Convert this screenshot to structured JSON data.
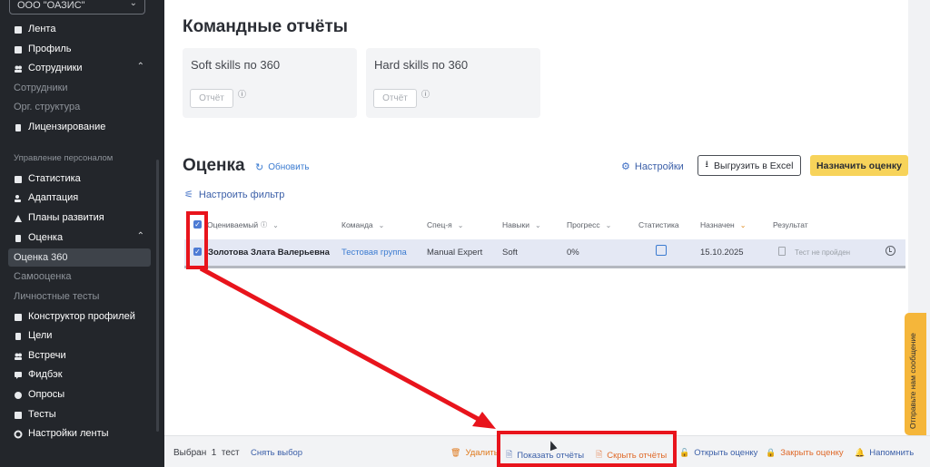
{
  "sidebar": {
    "org": "ООО \"ОАЗИС\"",
    "items": [
      {
        "label": "Лента"
      },
      {
        "label": "Профиль"
      },
      {
        "label": "Сотрудники"
      },
      {
        "label": "Сотрудники"
      },
      {
        "label": "Орг. структура"
      },
      {
        "label": "Лицензирование"
      },
      {
        "label": "Управление персоналом"
      },
      {
        "label": "Статистика"
      },
      {
        "label": "Адаптация"
      },
      {
        "label": "Планы развития"
      },
      {
        "label": "Оценка"
      },
      {
        "label": "Оценка 360"
      },
      {
        "label": "Самооценка"
      },
      {
        "label": "Личностные тесты"
      },
      {
        "label": "Конструктор профилей"
      },
      {
        "label": "Цели"
      },
      {
        "label": "Встречи"
      },
      {
        "label": "Фидбэк"
      },
      {
        "label": "Опросы"
      },
      {
        "label": "Тесты"
      },
      {
        "label": "Настройки ленты"
      }
    ]
  },
  "team_reports": {
    "title": "Командные отчёты",
    "cards": [
      {
        "title": "Soft skills по 360",
        "button": "Отчёт"
      },
      {
        "title": "Hard skills по 360",
        "button": "Отчёт"
      }
    ]
  },
  "evaluation": {
    "title": "Оценка",
    "refresh": "Обновить",
    "settings": "Настройки",
    "export": "Выгрузить в Excel",
    "assign": "Назначить оценку",
    "filter": "Настроить фильтр"
  },
  "table": {
    "headers": [
      "Оцениваемый",
      "Команда",
      "Спец-я",
      "Навыки",
      "Прогресс",
      "Статистика",
      "Назначен",
      "Результат"
    ],
    "row": {
      "name": "Золотова Злата Валерьевна",
      "team": "Тестовая группа",
      "spec": "Manual Expert",
      "skills": "Soft",
      "progress": "0%",
      "assigned": "15.10.2025",
      "result": "Тест не пройден"
    }
  },
  "bottom_bar": {
    "selected_label": "Выбран",
    "selected_count": "1",
    "selected_unit": "тест",
    "reset": "Снять выбор",
    "delete": "Удалить",
    "show_reports": "Показать отчёты",
    "hide_reports": "Скрыть отчёты",
    "open_eval": "Открыть оценку",
    "close_eval": "Закрыть оценку",
    "remind": "Напомнить"
  },
  "feedback_tab": "Отправьте нам сообщение",
  "colors": {
    "sidebar_bg": "#23262b",
    "accent_yellow": "#f7d35a",
    "link_blue": "#3b7bd0",
    "annotation_red": "#e8141c",
    "feedback_orange": "#f5b63a"
  }
}
